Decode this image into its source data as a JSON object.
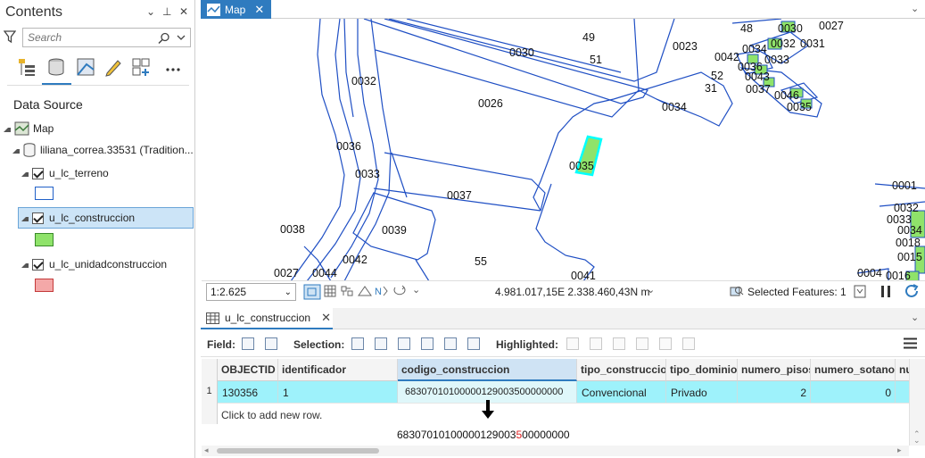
{
  "contents": {
    "title": "Contents",
    "controls": [
      "⌄",
      "⊥",
      "✕"
    ],
    "search_placeholder": "Search",
    "section_title": "Data Source",
    "tree": {
      "map_label": "Map",
      "db_label": "liliana_correa.33531 (Tradition...",
      "layers": [
        {
          "name": "u_lc_terreno",
          "checked": true,
          "fill": "#ffffff",
          "stroke": "#2060c8"
        },
        {
          "name": "u_lc_construccion",
          "checked": true,
          "fill": "#8fe36a",
          "stroke": "#3a8a2a",
          "selected": true
        },
        {
          "name": "u_lc_unidadconstruccion",
          "checked": true,
          "fill": "#f4a8a8",
          "stroke": "#c43a3a"
        }
      ]
    }
  },
  "map": {
    "tab_label": "Map",
    "parcel_labels": [
      "49",
      "0023",
      "0030",
      "51",
      "0042",
      "52",
      "31",
      "0032",
      "0026",
      "0034",
      "0035",
      "0036",
      "0033",
      "0037",
      "0038",
      "0039",
      "0042",
      "55",
      "0027",
      "0044",
      "0041",
      "48",
      "0034",
      "0032",
      "0031",
      "0036",
      "0043",
      "0037",
      "0033",
      "0046",
      "0035",
      "0030",
      "0027",
      "0001",
      "0032",
      "0033",
      "0034",
      "0018",
      "0015",
      "0004",
      "0016"
    ],
    "scale": "1:2.625",
    "coordinates": "4.981.017,15E 2.338.460,43N m",
    "selected_features": "Selected Features: 1",
    "colors": {
      "parcel": "#1f4fc4",
      "building_fill": "#8fe36a",
      "selection": "#00ffff"
    }
  },
  "table": {
    "tab_label": "u_lc_construccion",
    "toolbar": {
      "field_label": "Field:",
      "selection_label": "Selection:",
      "highlighted_label": "Highlighted:"
    },
    "columns": [
      "OBJECTID *",
      "identificador",
      "codigo_construccion",
      "tipo_construccion",
      "tipo_dominio",
      "numero_pisos",
      "numero_sotanos",
      "nu"
    ],
    "rows": [
      {
        "row_num": "1",
        "cells": [
          "130356",
          "1",
          "68307010100000129003500000000",
          "Convencional",
          "Privado",
          "2",
          "0",
          ""
        ]
      }
    ],
    "new_row_text": "Click to add new row.",
    "annotation": {
      "prefix": "68307010100000129003",
      "highlight": "5",
      "suffix": "00000000",
      "highlight_color": "#e02020"
    }
  }
}
